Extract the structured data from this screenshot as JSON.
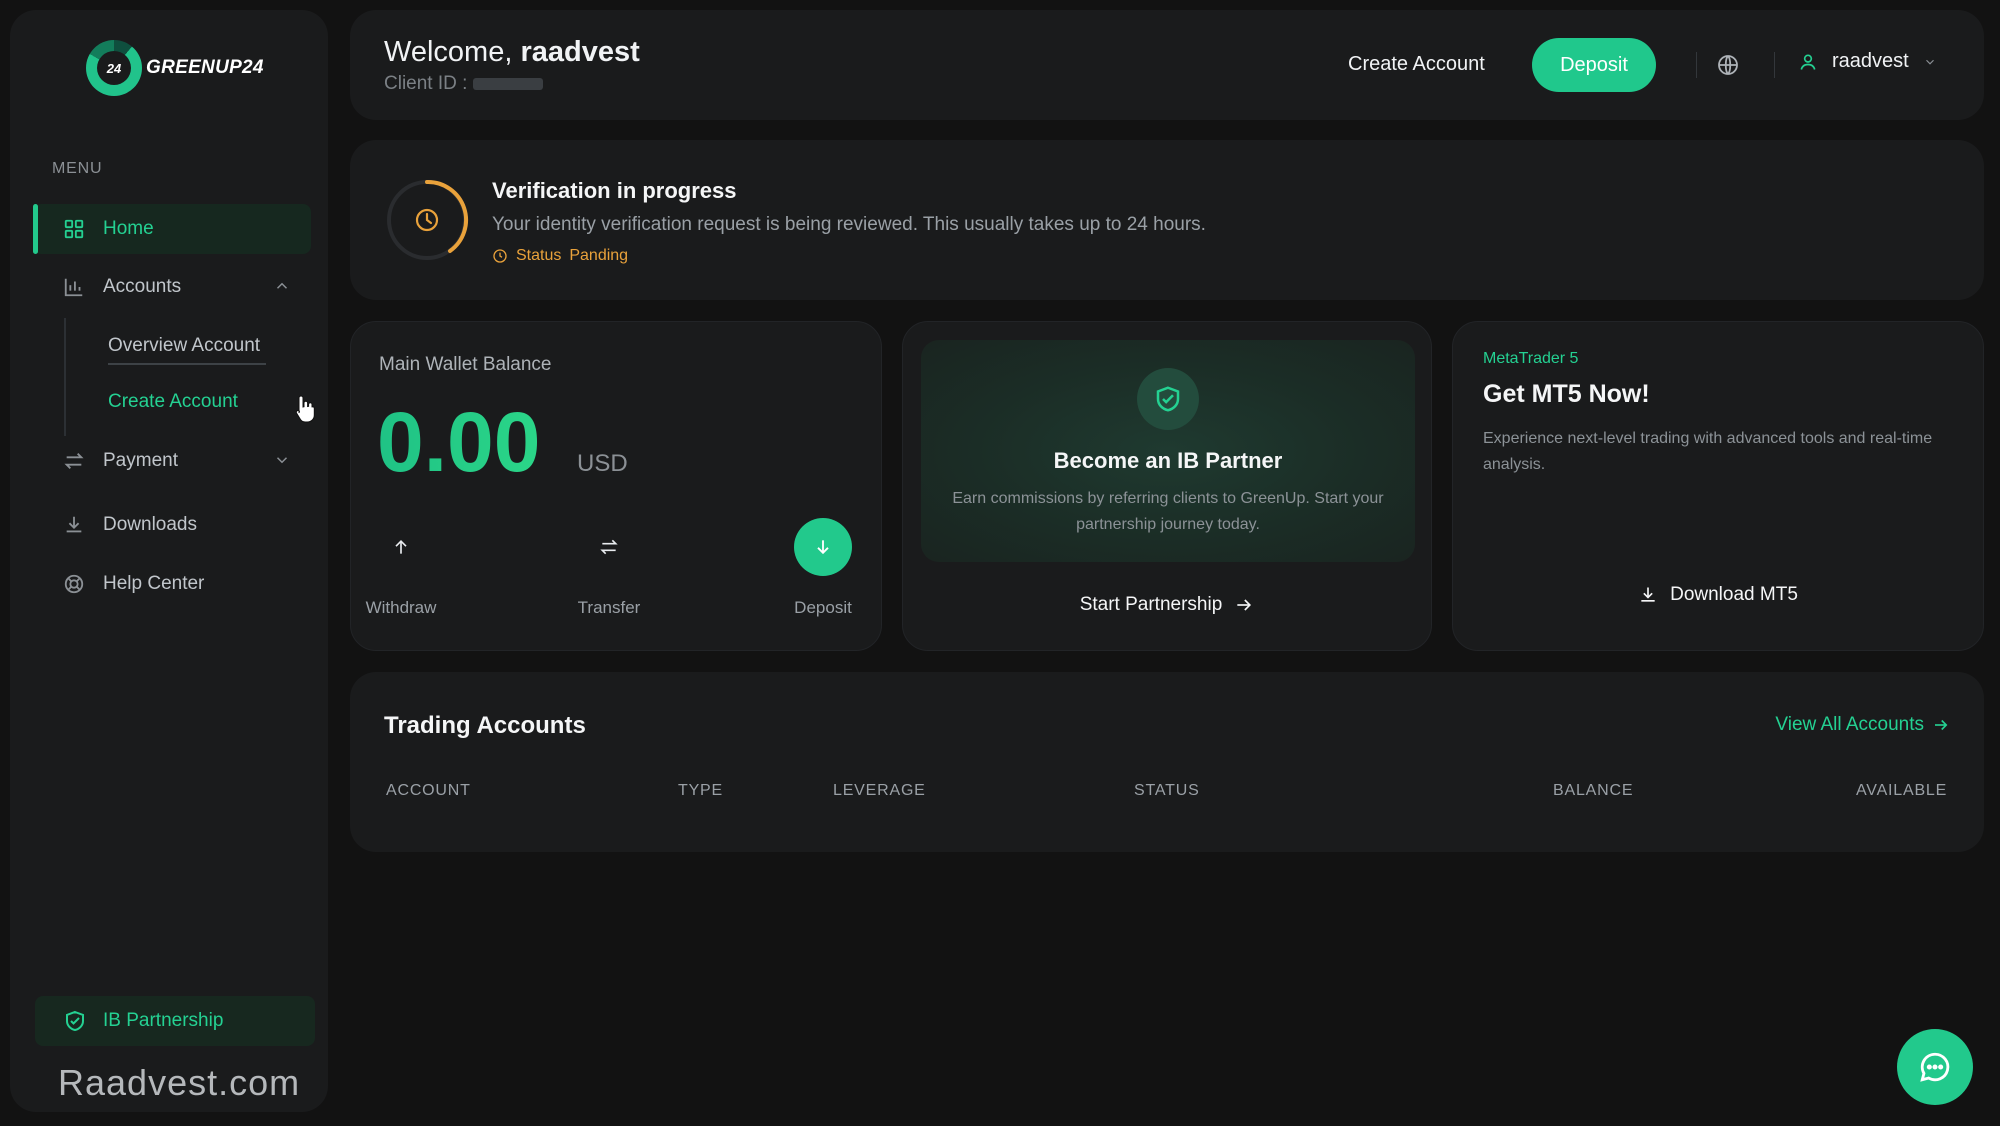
{
  "brand": {
    "logo_mark": "24",
    "logo_text": "GREENUP24"
  },
  "sidebar": {
    "menu_heading": "MENU",
    "items": [
      {
        "label": "Home",
        "icon": "grid-icon",
        "active": true
      },
      {
        "label": "Accounts",
        "icon": "bar-chart-icon",
        "expanded": true
      },
      {
        "label": "Payment",
        "icon": "swap-icon",
        "expanded": false
      },
      {
        "label": "Downloads",
        "icon": "download-icon"
      },
      {
        "label": "Help Center",
        "icon": "lifebuoy-icon"
      }
    ],
    "accounts_sub": [
      {
        "label": "Overview Account"
      },
      {
        "label": "Create Account",
        "active": true
      }
    ],
    "ib_partnership": "IB Partnership",
    "watermark": "Raadvest.com"
  },
  "header": {
    "welcome_prefix": "Welcome, ",
    "username": "raadvest",
    "client_id_label": "Client ID :",
    "create_account": "Create Account",
    "deposit": "Deposit",
    "user_menu": "raadvest"
  },
  "verification": {
    "title": "Verification in progress",
    "description": "Your identity verification request is being reviewed. This usually takes up to 24 hours.",
    "status_label": "Status",
    "status_value": "Panding"
  },
  "wallet": {
    "label": "Main Wallet Balance",
    "amount": "0.00",
    "currency": "USD",
    "actions": {
      "withdraw": "Withdraw",
      "transfer": "Transfer",
      "deposit": "Deposit"
    }
  },
  "ib_card": {
    "title": "Become an IB Partner",
    "description": "Earn commissions by referring clients to GreenUp. Start your partnership journey today.",
    "link": "Start Partnership"
  },
  "mt5_card": {
    "kicker": "MetaTrader 5",
    "title": "Get MT5 Now!",
    "description": "Experience next-level trading with advanced tools and real-time analysis.",
    "link": "Download MT5"
  },
  "trading": {
    "title": "Trading Accounts",
    "view_all": "View All Accounts",
    "columns": [
      "ACCOUNT",
      "TYPE",
      "LEVERAGE",
      "STATUS",
      "BALANCE",
      "AVAILABLE"
    ]
  },
  "colors": {
    "accent": "#22c98c",
    "background": "#121212",
    "card": "#1a1b1c",
    "pending": "#e9a23b"
  }
}
